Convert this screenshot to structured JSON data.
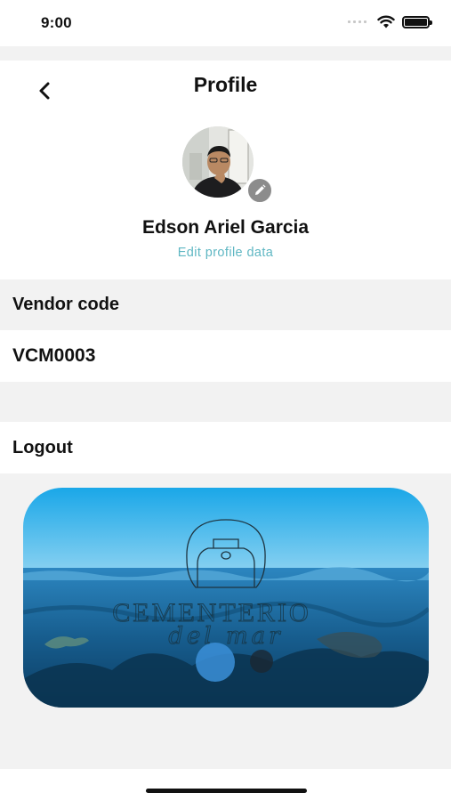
{
  "status_bar": {
    "time": "9:00",
    "icons": [
      "signal-dots-icon",
      "wifi-icon",
      "battery-icon"
    ]
  },
  "header": {
    "title": "Profile",
    "back_icon": "chevron-left-icon"
  },
  "profile": {
    "name": "Edson Ariel Garcia",
    "edit_link": "Edit profile data",
    "avatar_badge_icon": "pencil-icon"
  },
  "vendor": {
    "label": "Vendor code",
    "value": "VCM0003"
  },
  "actions": {
    "logout_label": "Logout"
  },
  "banner": {
    "logo_text_line1": "CEMENTERIO",
    "logo_text_line2": "del mar"
  },
  "colors": {
    "accent": "#5fb7c3",
    "section_background": "#f2f2f2",
    "edit_badge": "#8c8c8c"
  }
}
